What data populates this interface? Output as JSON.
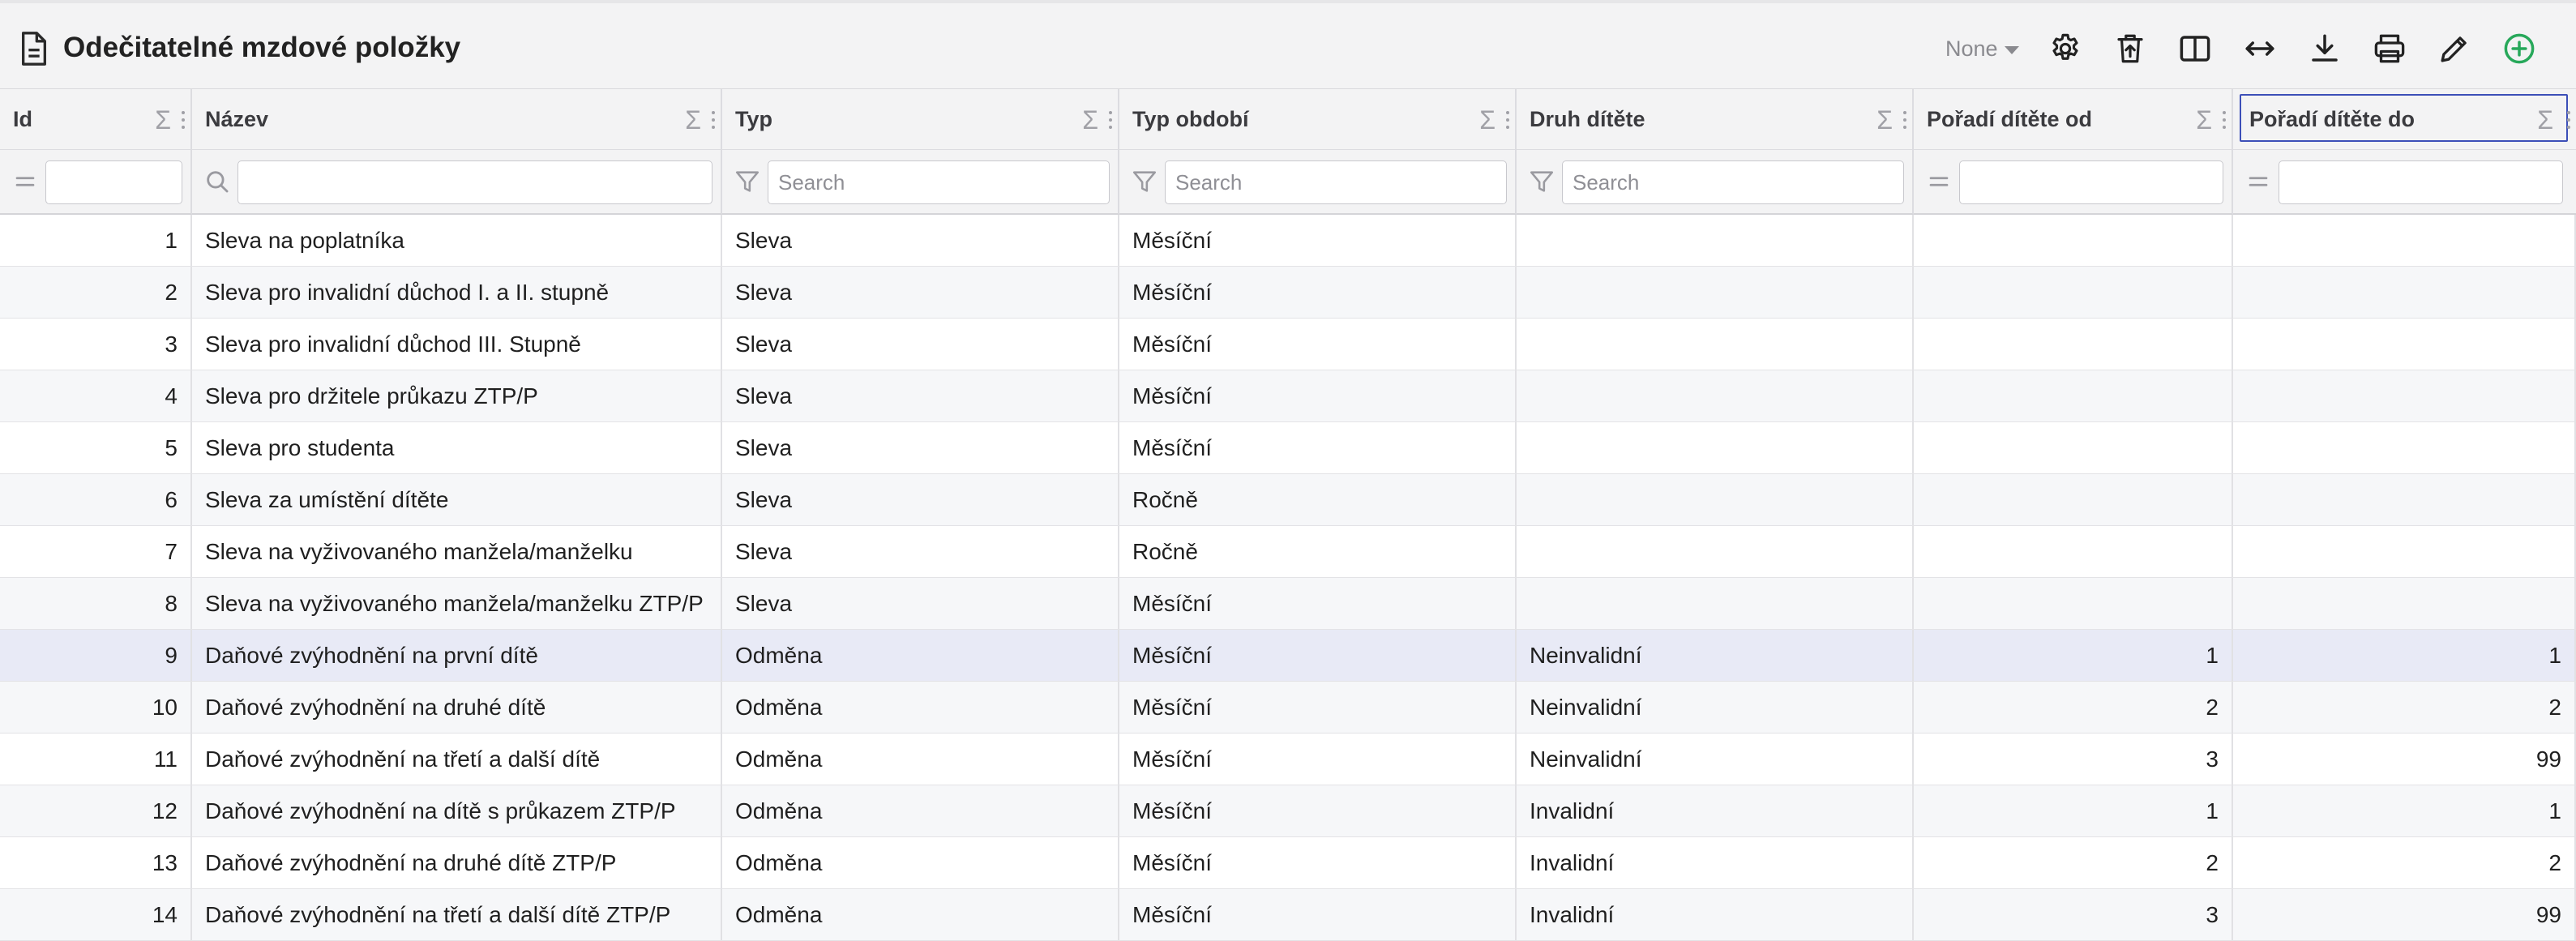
{
  "title": "Odečitatelné mzdové položky",
  "toolbar": {
    "grouping_label": "None"
  },
  "columns": [
    {
      "label": "Id"
    },
    {
      "label": "Název"
    },
    {
      "label": "Typ"
    },
    {
      "label": "Typ období"
    },
    {
      "label": "Druh dítěte"
    },
    {
      "label": "Pořadí dítěte od"
    },
    {
      "label": "Pořadí dítěte do"
    }
  ],
  "filters": {
    "typ_placeholder": "Search",
    "typ_obdobi_placeholder": "Search",
    "druh_ditete_placeholder": "Search"
  },
  "rows": [
    {
      "id": "1",
      "nazev": "Sleva na poplatníka",
      "typ": "Sleva",
      "obdobi": "Měsíční",
      "druh": "",
      "od": "",
      "do": ""
    },
    {
      "id": "2",
      "nazev": "Sleva pro invalidní důchod I. a II. stupně",
      "typ": "Sleva",
      "obdobi": "Měsíční",
      "druh": "",
      "od": "",
      "do": ""
    },
    {
      "id": "3",
      "nazev": "Sleva pro invalidní důchod III. Stupně",
      "typ": "Sleva",
      "obdobi": "Měsíční",
      "druh": "",
      "od": "",
      "do": ""
    },
    {
      "id": "4",
      "nazev": "Sleva pro držitele průkazu ZTP/P",
      "typ": "Sleva",
      "obdobi": "Měsíční",
      "druh": "",
      "od": "",
      "do": ""
    },
    {
      "id": "5",
      "nazev": "Sleva pro studenta",
      "typ": "Sleva",
      "obdobi": "Měsíční",
      "druh": "",
      "od": "",
      "do": ""
    },
    {
      "id": "6",
      "nazev": "Sleva za umístění dítěte",
      "typ": "Sleva",
      "obdobi": "Ročně",
      "druh": "",
      "od": "",
      "do": ""
    },
    {
      "id": "7",
      "nazev": "Sleva na vyživovaného manžela/manželku",
      "typ": "Sleva",
      "obdobi": "Ročně",
      "druh": "",
      "od": "",
      "do": ""
    },
    {
      "id": "8",
      "nazev": "Sleva na vyživovaného manžela/manželku ZTP/P",
      "typ": "Sleva",
      "obdobi": "Měsíční",
      "druh": "",
      "od": "",
      "do": ""
    },
    {
      "id": "9",
      "nazev": "Daňové zvýhodnění na první dítě",
      "typ": "Odměna",
      "obdobi": "Měsíční",
      "druh": "Neinvalidní",
      "od": "1",
      "do": "1"
    },
    {
      "id": "10",
      "nazev": "Daňové zvýhodnění na druhé dítě",
      "typ": "Odměna",
      "obdobi": "Měsíční",
      "druh": "Neinvalidní",
      "od": "2",
      "do": "2"
    },
    {
      "id": "11",
      "nazev": "Daňové zvýhodnění na třetí a další dítě",
      "typ": "Odměna",
      "obdobi": "Měsíční",
      "druh": "Neinvalidní",
      "od": "3",
      "do": "99"
    },
    {
      "id": "12",
      "nazev": "Daňové zvýhodnění na dítě s průkazem ZTP/P",
      "typ": "Odměna",
      "obdobi": "Měsíční",
      "druh": "Invalidní",
      "od": "1",
      "do": "1"
    },
    {
      "id": "13",
      "nazev": "Daňové zvýhodnění na druhé dítě ZTP/P",
      "typ": "Odměna",
      "obdobi": "Měsíční",
      "druh": "Invalidní",
      "od": "2",
      "do": "2"
    },
    {
      "id": "14",
      "nazev": "Daňové zvýhodnění na třetí a další dítě ZTP/P",
      "typ": "Odměna",
      "obdobi": "Měsíční",
      "druh": "Invalidní",
      "od": "3",
      "do": "99"
    }
  ]
}
